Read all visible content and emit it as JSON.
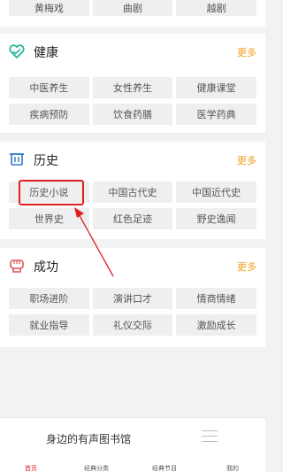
{
  "top_row": {
    "items": [
      "黄梅戏",
      "曲剧",
      "越剧"
    ]
  },
  "sections": [
    {
      "title": "健康",
      "more": "更多",
      "icon": "heart-icon",
      "items": [
        "中医养生",
        "女性养生",
        "健康课堂",
        "疾病预防",
        "饮食药膳",
        "医学药典"
      ]
    },
    {
      "title": "历史",
      "more": "更多",
      "icon": "temple-icon",
      "items": [
        "历史小说",
        "中国古代史",
        "中国近代史",
        "世界史",
        "红色足迹",
        "野史逸闻"
      ]
    },
    {
      "title": "成功",
      "more": "更多",
      "icon": "fist-icon",
      "items": [
        "职场进阶",
        "演讲口才",
        "情商情绪",
        "就业指导",
        "礼仪交际",
        "激励成长"
      ]
    }
  ],
  "banner": {
    "text": "身边的有声图书馆"
  },
  "tabbar": {
    "items": [
      "首页",
      "经典分类",
      "经典节目",
      "我的"
    ]
  },
  "colors": {
    "accent": "#f1a020",
    "active": "#e02020",
    "icon_teal": "#2cb39a",
    "icon_blue": "#2e79c7"
  }
}
